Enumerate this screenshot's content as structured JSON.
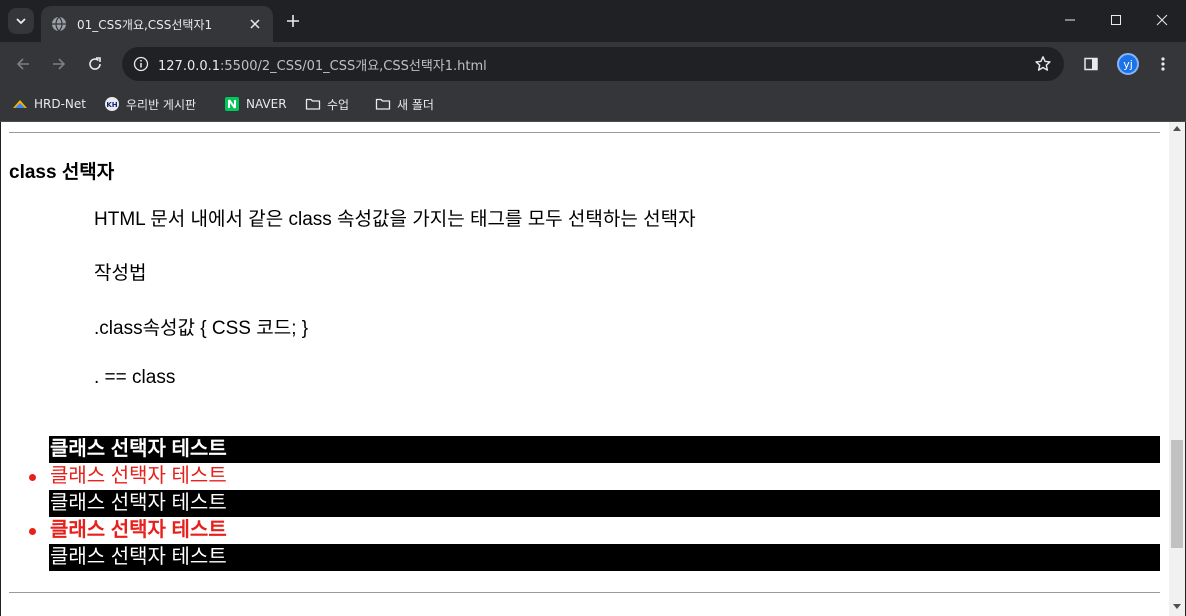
{
  "browser": {
    "tab": {
      "title": "01_CSS개요,CSS선택자1",
      "icon": "globe-icon"
    },
    "address": {
      "host": "127.0.0.1",
      "path": ":5500/2_CSS/01_CSS개요,CSS선택자1.html"
    },
    "profile_initials": "yj",
    "bookmarks": [
      {
        "label": "HRD-Net",
        "icon": "hrd-net-icon"
      },
      {
        "label": "우리반 게시판",
        "icon": "board-icon"
      },
      {
        "label": "NAVER",
        "icon": "naver-icon"
      },
      {
        "label": "수업",
        "icon": "folder-icon"
      },
      {
        "label": "새 폴더",
        "icon": "folder-icon"
      }
    ]
  },
  "content": {
    "heading": "class 선택자",
    "lines": [
      "HTML 문서 내에서 같은 class 속성값을 가지는 태그를 모두 선택하는 선택자",
      "작성법",
      ".class속성값 { CSS 코드; }",
      ". == class"
    ],
    "items": [
      {
        "text": "클래스 선택자 테스트",
        "style": "black bold"
      },
      {
        "text": "클래스 선택자 테스트",
        "style": "red",
        "bullet": true
      },
      {
        "text": "클래스 선택자 테스트",
        "style": "black"
      },
      {
        "text": "클래스 선택자 테스트",
        "style": "red bold",
        "bullet": true
      },
      {
        "text": "클래스 선택자 테스트",
        "style": "black"
      }
    ]
  },
  "colors": {
    "accent_red": "#e8201c",
    "page_bg": "#ffffff",
    "chrome_bg": "#35363a"
  }
}
